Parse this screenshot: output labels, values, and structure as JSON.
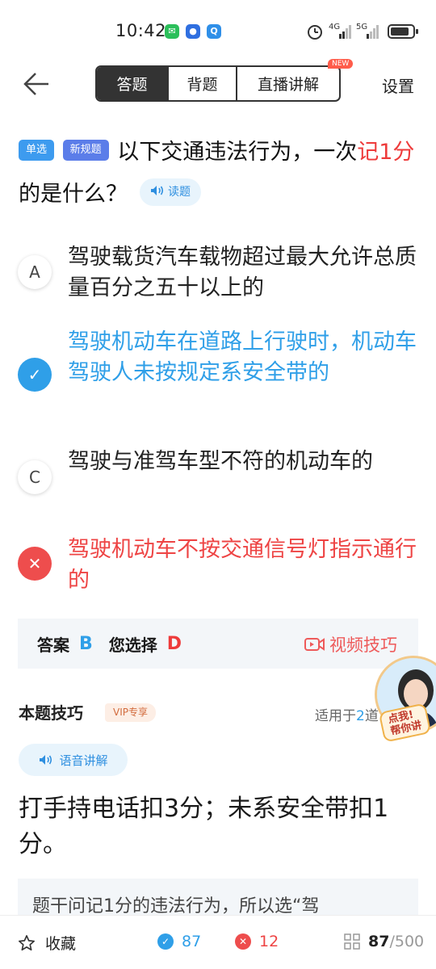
{
  "status_bar": {
    "time": "10:42",
    "net1": "4G",
    "net2": "5G"
  },
  "nav": {
    "tabs": [
      {
        "label": "答题",
        "active": true
      },
      {
        "label": "背题",
        "active": false
      },
      {
        "label": "直播讲解",
        "active": false
      }
    ],
    "new_badge": "NEW",
    "settings": "设置"
  },
  "question": {
    "tag_type": "单选",
    "tag_rule": "新规题",
    "text_before": "以下交通违法行为，一次",
    "highlight": "记1分",
    "text_after": "的是什么？",
    "read_label": "读题"
  },
  "options": [
    {
      "mark": "A",
      "text": "驾驶载货汽车载物超过最大允许总质量百分之五十以上的",
      "state": "normal"
    },
    {
      "mark": "✓",
      "text": "驾驶机动车在道路上行驶时，机动车驾驶人未按规定系安全带的",
      "state": "correct"
    },
    {
      "mark": "C",
      "text": "驾驶与准驾车型不符的机动车的",
      "state": "normal"
    },
    {
      "mark": "✕",
      "text": "驾驶机动车不按交通信号灯指示通行的",
      "state": "wrong"
    }
  ],
  "answer": {
    "answer_label": "答案",
    "answer_value": "B",
    "chosen_label": "您选择",
    "chosen_value": "D",
    "video_tip": "视频技巧"
  },
  "tips": {
    "title": "本题技巧",
    "vip": "VIP专享",
    "applies_prefix": "适用于",
    "applies_num": "2",
    "applies_suffix": "道",
    "voice_label": "语音讲解",
    "body": "打手持电话扣3分；未系安全带扣1分。",
    "explanation": "题干问记1分的违法行为，所以选“驾"
  },
  "avatar": {
    "label_line1": "点我!",
    "label_line2": "帮你讲"
  },
  "bottom": {
    "favorite": "收藏",
    "correct_count": "87",
    "wrong_count": "12",
    "current": "87",
    "total": "/500"
  },
  "colors": {
    "blue": "#2f9fe8",
    "red": "#ee4444",
    "dark": "#333333"
  }
}
